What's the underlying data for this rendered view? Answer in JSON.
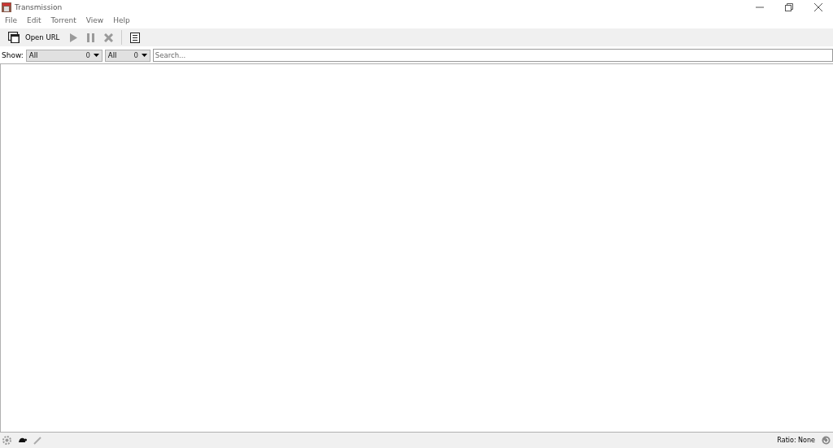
{
  "window": {
    "title": "Transmission"
  },
  "menu": [
    "File",
    "Edit",
    "Torrent",
    "View",
    "Help"
  ],
  "toolbar": [
    {
      "kind": "open",
      "label": "Open URL",
      "disabled": false
    },
    {
      "kind": "start",
      "disabled": true
    },
    {
      "kind": "pause",
      "disabled": true
    },
    {
      "kind": "remove",
      "disabled": true
    },
    {
      "kind": "properties",
      "disabled": false
    }
  ],
  "filter_bar": {
    "label": "Show:",
    "filters": [
      {
        "value": "All",
        "count": "0"
      },
      {
        "value": "All",
        "count": "0"
      }
    ],
    "search": {
      "placeholder": "Search..."
    }
  },
  "status_bar": {
    "ratio": "Ratio: None"
  }
}
